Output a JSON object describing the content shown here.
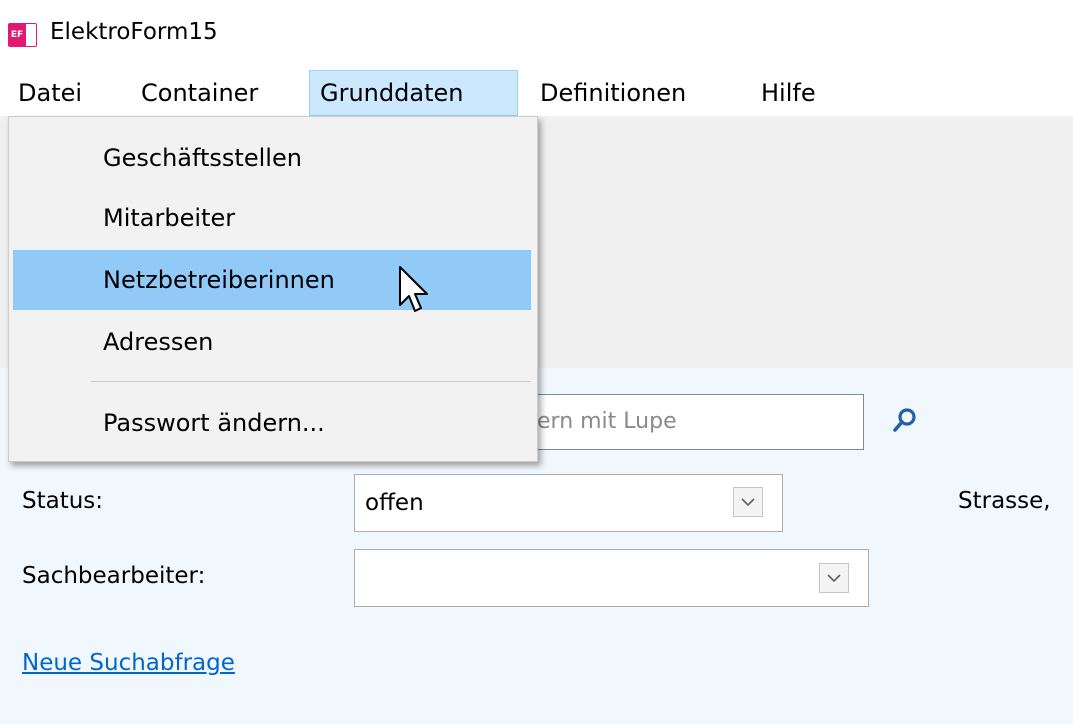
{
  "window": {
    "title": "ElektroForm15",
    "icon_text": "EF"
  },
  "menubar": {
    "items": [
      "Datei",
      "Container",
      "Grunddaten",
      "Definitionen",
      "Hilfe"
    ],
    "active_item": "Grunddaten"
  },
  "dropdown": {
    "items": [
      "Geschäftsstellen",
      "Mitarbeiter",
      "Netzbetreiberinnen",
      "Adressen"
    ],
    "hovered_item": "Netzbetreiberinnen",
    "after_separator": "Passwort ändern..."
  },
  "search": {
    "placeholder_visible": "ern mit Lupe"
  },
  "filters": {
    "status_label": "Status:",
    "status_value": "offen",
    "clerk_label": "Sachbearbeiter:",
    "clerk_value": "",
    "street_label": "Strasse,"
  },
  "links": {
    "new_query": "Neue Suchabfrage"
  },
  "colors": {
    "menu_active_bg": "#cce8ff",
    "menu_hover_bg": "#91c9f7",
    "link": "#0066cc",
    "app_icon": "#e2196f",
    "search_icon": "#1f5fa8"
  }
}
